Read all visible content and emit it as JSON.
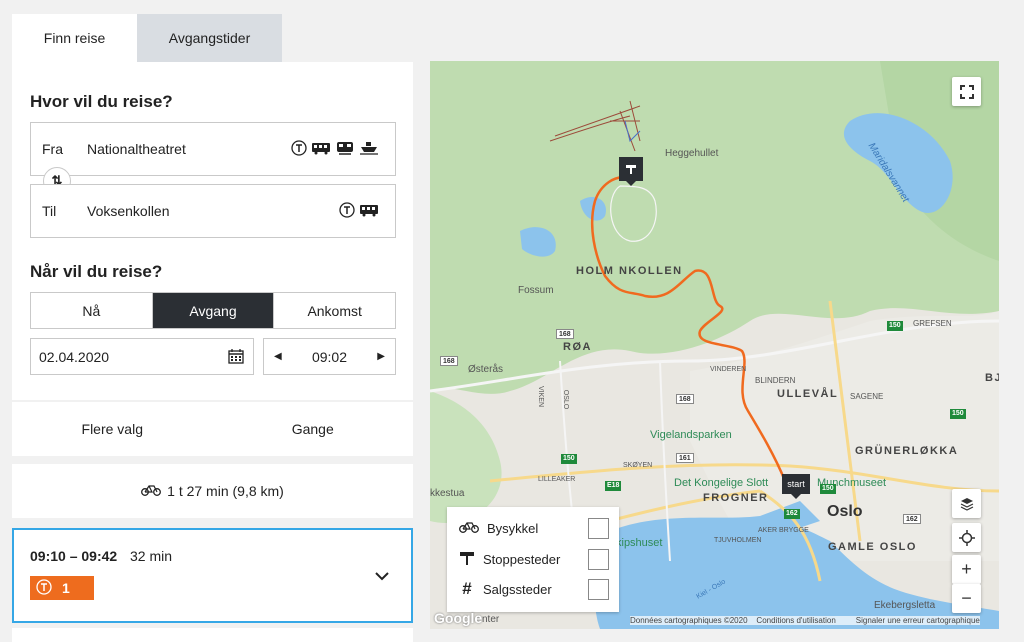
{
  "tabs": {
    "find_trip": "Finn reise",
    "departures": "Avgangstider"
  },
  "form": {
    "where_heading": "Hvor vil du reise?",
    "from_label": "Fra",
    "from_value": "Nationaltheatret",
    "to_label": "Til",
    "to_value": "Voksenkollen",
    "swap_icon": "⇅",
    "when_heading": "Når vil du reise?",
    "time_modes": [
      "Nå",
      "Avgang",
      "Ankomst"
    ],
    "selected_mode": "Avgang",
    "date": "02.04.2020",
    "time": "09:02"
  },
  "options": {
    "more": "Flere valg",
    "walk": "Gange"
  },
  "bike_summary": "1 t 27 min (9,8 km)",
  "trip": {
    "times": "09:10 – 09:42",
    "duration": "32 min",
    "line": "1"
  },
  "map": {
    "labels": {
      "heggehullet": "Heggehullet",
      "maridalsvannet": "Maridalsvannet",
      "holmenkollen": "HOLM NKOLLEN",
      "fossum": "Fossum",
      "roa": "RØA",
      "osteras": "Østerås",
      "blindern": "BLINDERN",
      "ulleval": "ULLEVÅL",
      "sagene": "SAGENE",
      "grefsen": "GREFSEN",
      "vinderen": "VINDEREN",
      "vigeland": "Vigelandsparken",
      "grunerlokka": "GRÜNERLØKKA",
      "slott": "Det Kongelige Slott",
      "munch": "Munchmuseet",
      "frogner": "FROGNER",
      "skoyen": "SKØYEN",
      "lilleaker": "LILLEAKER",
      "stua": "kkestua",
      "oslo": "Oslo",
      "aker": "AKER BRYGGE",
      "tjuv": "TJUVHOLMEN",
      "gamle": "GAMLE OSLO",
      "kips": "kipshuset",
      "ekeberg": "Ekebergsletta",
      "viken": "VIKEN",
      "oslo_road": "OSLO",
      "kiel": "Kiel - Oslo",
      "senter": "nter",
      "bj": "BJ"
    },
    "start_pin": "start",
    "legend": {
      "bike": "Bysykkel",
      "stops": "Stoppesteder",
      "sales": "Salgssteder"
    },
    "footer": {
      "data": "Données cartographiques ©2020",
      "terms": "Conditions d'utilisation",
      "report": "Signaler une erreur cartographique"
    },
    "google": "Google",
    "zoom_in": "+",
    "zoom_out": "−",
    "route_color": "#f06a1f"
  }
}
